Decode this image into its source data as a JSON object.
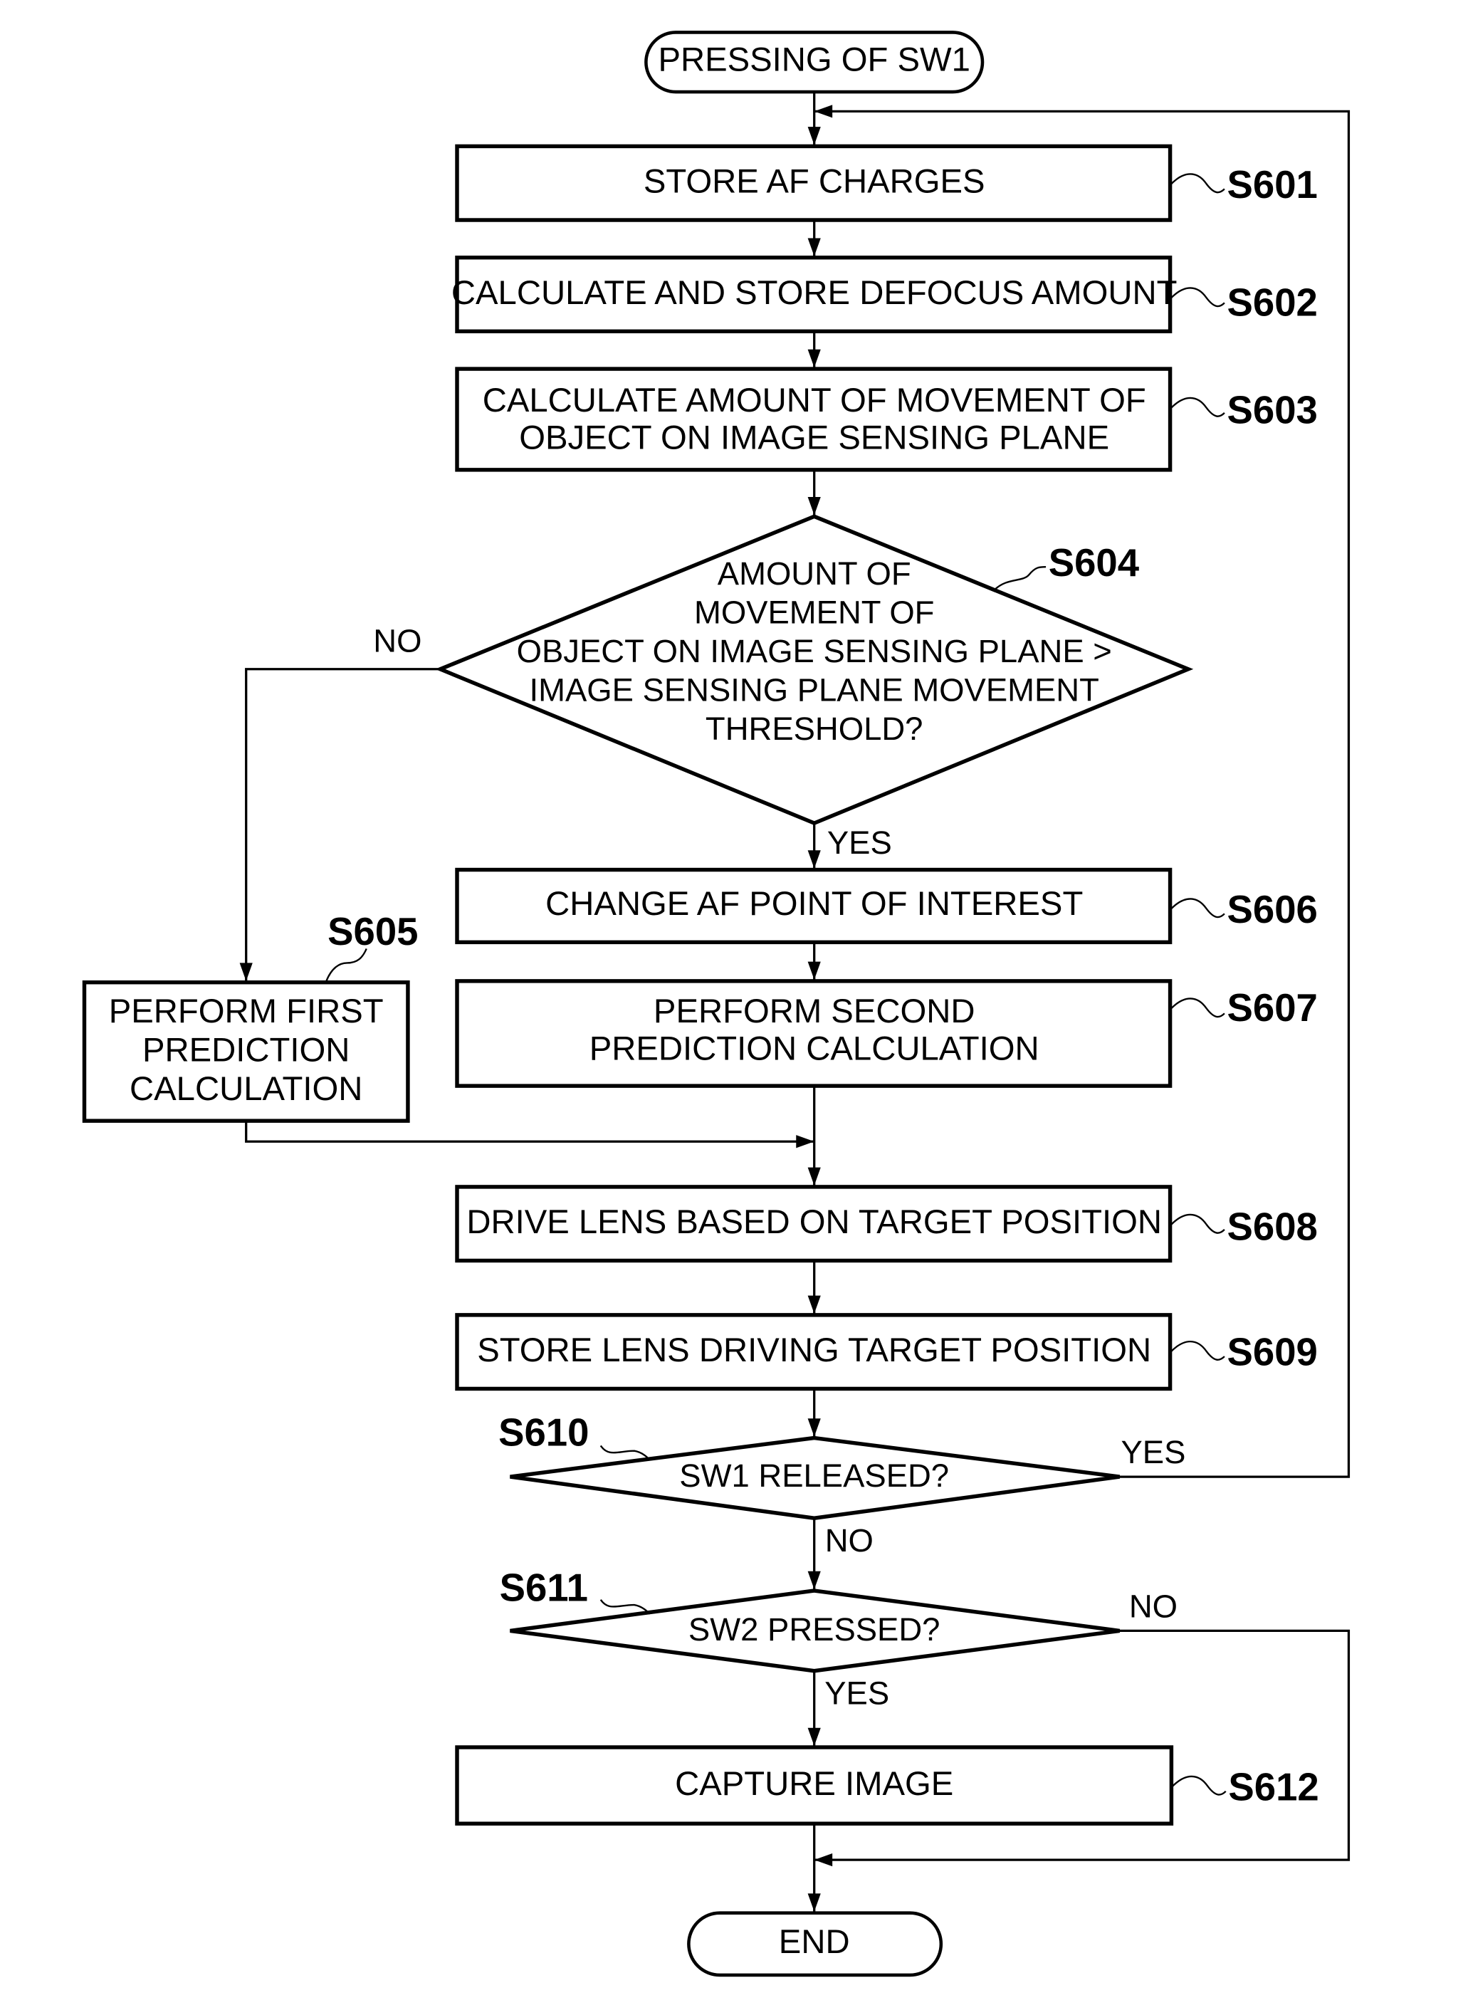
{
  "start": {
    "label": "PRESSING OF SW1"
  },
  "end": {
    "label": "END"
  },
  "steps": {
    "s601": {
      "id": "S601",
      "lines": [
        "STORE AF CHARGES"
      ]
    },
    "s602": {
      "id": "S602",
      "lines": [
        "CALCULATE AND STORE DEFOCUS AMOUNT"
      ]
    },
    "s603": {
      "id": "S603",
      "lines": [
        "CALCULATE AMOUNT OF MOVEMENT OF",
        "OBJECT ON IMAGE SENSING PLANE"
      ]
    },
    "s604": {
      "id": "S604",
      "lines": [
        "AMOUNT OF",
        "MOVEMENT OF",
        "OBJECT ON IMAGE SENSING PLANE >",
        "IMAGE SENSING PLANE MOVEMENT",
        "THRESHOLD?"
      ],
      "no_label": "NO",
      "yes_label": "YES"
    },
    "s605": {
      "id": "S605",
      "lines": [
        "PERFORM FIRST",
        "PREDICTION",
        "CALCULATION"
      ]
    },
    "s606": {
      "id": "S606",
      "lines": [
        "CHANGE AF POINT OF INTEREST"
      ]
    },
    "s607": {
      "id": "S607",
      "lines": [
        "PERFORM SECOND",
        "PREDICTION CALCULATION"
      ]
    },
    "s608": {
      "id": "S608",
      "lines": [
        "DRIVE LENS BASED ON TARGET POSITION"
      ]
    },
    "s609": {
      "id": "S609",
      "lines": [
        "STORE LENS DRIVING TARGET POSITION"
      ]
    },
    "s610": {
      "id": "S610",
      "lines": [
        "SW1 RELEASED?"
      ],
      "yes_label": "YES",
      "no_label": "NO"
    },
    "s611": {
      "id": "S611",
      "lines": [
        "SW2 PRESSED?"
      ],
      "yes_label": "YES",
      "no_label": "NO"
    },
    "s612": {
      "id": "S612",
      "lines": [
        "CAPTURE IMAGE"
      ]
    }
  }
}
